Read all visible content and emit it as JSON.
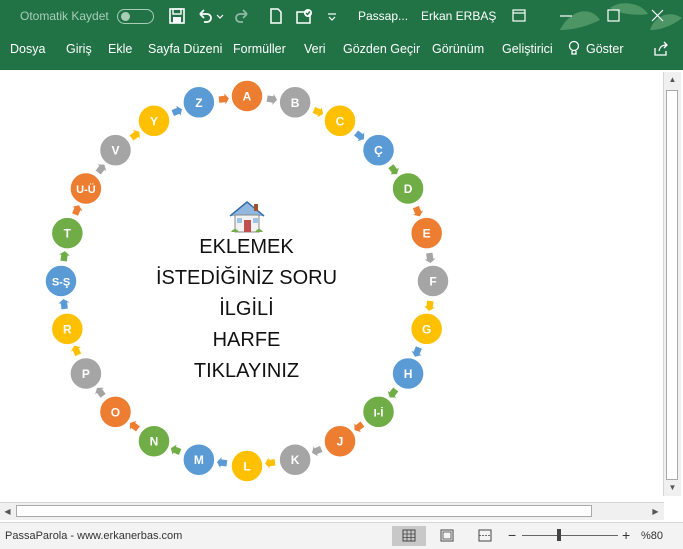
{
  "titlebar": {
    "autosave_label": "Otomatik Kaydet",
    "doc_title": "Passap...",
    "user_name": "Erkan ERBAŞ"
  },
  "ribbon": {
    "tabs": [
      "Dosya",
      "Giriş",
      "Ekle",
      "Sayfa Düzeni",
      "Formüller",
      "Veri",
      "Gözden Geçir",
      "Görünüm",
      "Geliştirici",
      "Göster"
    ]
  },
  "center_lines": [
    "EKLEMEK",
    "İSTEDİĞİNİZ SORU",
    "İLGİLİ",
    "HARFE",
    "TIKLAYINIZ"
  ],
  "letters": [
    {
      "label": "A",
      "color": "#ED7D31"
    },
    {
      "label": "B",
      "color": "#A5A5A5"
    },
    {
      "label": "C",
      "color": "#FFC000"
    },
    {
      "label": "Ç",
      "color": "#5B9BD5"
    },
    {
      "label": "D",
      "color": "#70AD47"
    },
    {
      "label": "E",
      "color": "#ED7D31"
    },
    {
      "label": "F",
      "color": "#A5A5A5"
    },
    {
      "label": "G",
      "color": "#FFC000"
    },
    {
      "label": "H",
      "color": "#5B9BD5"
    },
    {
      "label": "I-İ",
      "color": "#70AD47"
    },
    {
      "label": "J",
      "color": "#ED7D31"
    },
    {
      "label": "K",
      "color": "#A5A5A5"
    },
    {
      "label": "L",
      "color": "#FFC000"
    },
    {
      "label": "M",
      "color": "#5B9BD5"
    },
    {
      "label": "N",
      "color": "#70AD47"
    },
    {
      "label": "O",
      "color": "#ED7D31"
    },
    {
      "label": "P",
      "color": "#A5A5A5"
    },
    {
      "label": "R",
      "color": "#FFC000"
    },
    {
      "label": "S-Ş",
      "color": "#5B9BD5"
    },
    {
      "label": "T",
      "color": "#70AD47"
    },
    {
      "label": "U-Ü",
      "color": "#ED7D31"
    },
    {
      "label": "V",
      "color": "#A5A5A5"
    },
    {
      "label": "Y",
      "color": "#FFC000"
    },
    {
      "label": "Z",
      "color": "#5B9BD5"
    }
  ],
  "statusbar": {
    "text": "PassaParola - www.erkanerbas.com",
    "zoom": "%80"
  },
  "colors": {
    "excel_green": "#217346"
  }
}
